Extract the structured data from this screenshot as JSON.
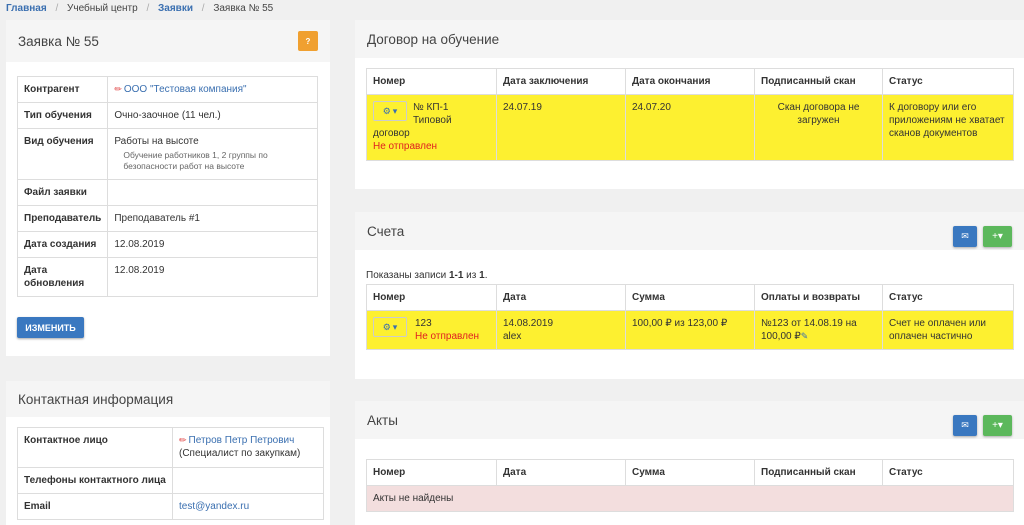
{
  "breadcrumb": {
    "home": "Главная",
    "center": "Учебный центр",
    "requests": "Заявки",
    "current": "Заявка № 55"
  },
  "request": {
    "title": "Заявка № 55",
    "help_label": "?",
    "rows": {
      "counterparty_label": "Контрагент",
      "counterparty_value": "ООО \"Тестовая компания\"",
      "type_label": "Тип обучения",
      "type_value": "Очно-заочное (11 чел.)",
      "kind_label": "Вид обучения",
      "kind_value": "Работы на высоте",
      "kind_sub": "Обучение работников 1, 2 группы по безопасности работ на высоте",
      "file_label": "Файл заявки",
      "file_value": "",
      "teacher_label": "Преподаватель",
      "teacher_value": "Преподаватель #1",
      "created_label": "Дата создания",
      "created_value": "12.08.2019",
      "updated_label": "Дата обновления",
      "updated_value": "12.08.2019"
    },
    "edit_label": "ИЗМЕНИТЬ"
  },
  "contact": {
    "title": "Контактная информация",
    "person_label": "Контактное лицо",
    "person_name": "Петров Петр Петрович",
    "person_role": "(Специалист по закупкам)",
    "phones_label": "Телефоны контактного лица",
    "email_label": "Email",
    "email_value": "test@yandex.ru"
  },
  "contract": {
    "title": "Договор на обучение",
    "headers": [
      "Номер",
      "Дата заключения",
      "Дата окончания",
      "Подписанный скан",
      "Статус"
    ],
    "row": {
      "number_line1": "№ КП-1",
      "number_line2": "Типовой",
      "number_line3": "договор",
      "number_status": "Не отправлен",
      "date_start": "24.07.19",
      "date_end": "24.07.20",
      "scan": "Скан договора не загружен",
      "status": "К договору или его приложениям не хватает сканов документов"
    }
  },
  "invoices": {
    "title": "Счета",
    "showing_prefix": "Показаны записи ",
    "showing_range": "1-1",
    "showing_mid": " из ",
    "showing_total": "1",
    "showing_suffix": ".",
    "headers": [
      "Номер",
      "Дата",
      "Сумма",
      "Оплаты и возвраты",
      "Статус"
    ],
    "row": {
      "number": "123",
      "number_status": "Не отправлен",
      "date": "14.08.2019",
      "author": "alex",
      "sum": "100,00 ₽ из 123,00 ₽",
      "payments": "№123 от 14.08.19 на 100,00 ₽",
      "status": "Счет не оплачен или оплачен частично"
    }
  },
  "acts": {
    "title": "Акты",
    "headers": [
      "Номер",
      "Дата",
      "Сумма",
      "Подписанный скан",
      "Статус"
    ],
    "empty": "Акты не найдены"
  },
  "icons": {
    "gear": "gear-icon",
    "mail": "mail-icon",
    "plus": "plus-icon",
    "pencil": "pencil-icon"
  },
  "colors": {
    "primary": "#3a78c0",
    "success": "#5cb85c",
    "warning": "#f0a030",
    "highlight": "#fdf030",
    "danger_bg": "#f3dede",
    "danger_text": "#e02020"
  }
}
